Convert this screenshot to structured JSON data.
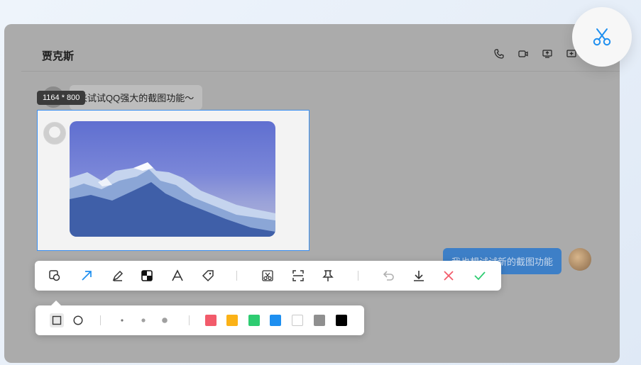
{
  "chat": {
    "contact_name": "贾克斯",
    "messages": {
      "left_text": "来试试QQ强大的截图功能～",
      "right_text": "我也想试试新的截图功能"
    },
    "actions": [
      "phone-icon",
      "video-icon",
      "screen-share-icon",
      "more-icon"
    ]
  },
  "screenshot": {
    "size_label": "1164 * 800"
  },
  "toolbar": {
    "tools": [
      "shape-tool-icon",
      "arrow-tool-icon",
      "pen-tool-icon",
      "mosaic-tool-icon",
      "text-tool-icon",
      "tag-tool-icon"
    ],
    "actions": [
      "screenshot-cut-icon",
      "scroll-capture-icon",
      "pin-icon",
      "undo-icon",
      "download-icon",
      "cancel-icon",
      "confirm-icon"
    ]
  },
  "subbar": {
    "shapes": [
      "rectangle-icon",
      "circle-icon"
    ],
    "sizes": [
      "small",
      "medium",
      "large"
    ],
    "colors": [
      "#f25b6b",
      "#fbb217",
      "#2ecc71",
      "#1e8ff0",
      "#ffffff",
      "#8f8f8f",
      "#000000"
    ]
  },
  "fab": {
    "icon": "scissors-icon",
    "accent": "#1e8ff0"
  }
}
